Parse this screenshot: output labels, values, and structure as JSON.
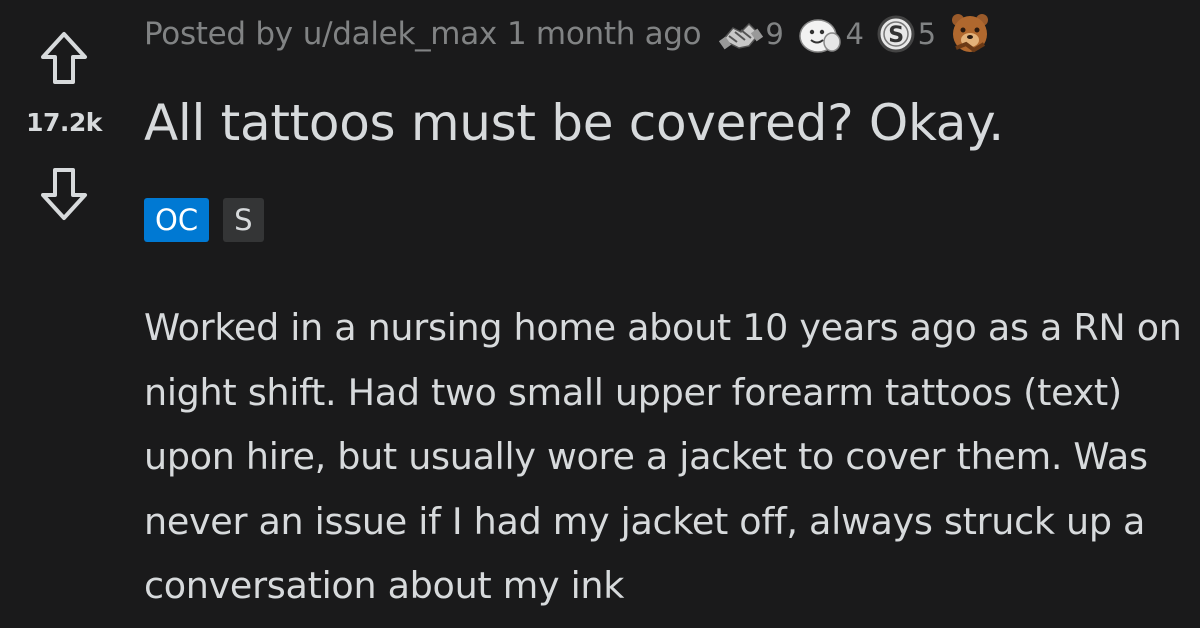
{
  "post": {
    "score": "17.2k",
    "meta": {
      "posted_by": "Posted by",
      "username": "u/dalek_max",
      "time": "1 month ago"
    },
    "awards": [
      {
        "icon": "handshake-award-icon",
        "count": "9"
      },
      {
        "icon": "wholesome-seal-award-icon",
        "count": "4"
      },
      {
        "icon": "silver-coin-award-icon",
        "count": "5"
      },
      {
        "icon": "bear-award-icon",
        "count": ""
      }
    ],
    "title": "All tattoos must be covered? Okay.",
    "flairs": {
      "oc": "OC",
      "spoiler": "S"
    },
    "body": "Worked in a nursing home about 10 years ago as a RN on night shift. Had two small upper forearm tattoos (text) upon hire, but usually wore a jacket to cover them. Was never an issue if I had my jacket off, always struck up a conversation about my ink"
  },
  "colors": {
    "background": "#1a1a1b",
    "text": "#d7dadc",
    "meta_text": "#818384",
    "oc_flair": "#0079d3",
    "spoiler_flair": "#343536"
  }
}
